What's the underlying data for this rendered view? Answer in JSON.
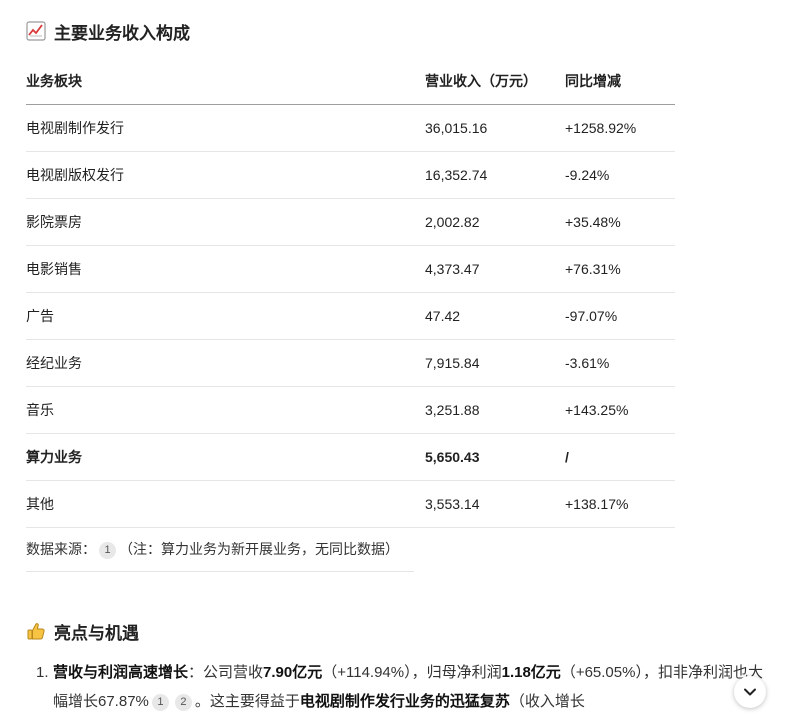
{
  "section1": {
    "icon": "chart-increasing-icon",
    "title": "主要业务收入构成"
  },
  "table": {
    "headers": [
      "业务板块",
      "营业收入（万元）",
      "同比增减"
    ],
    "rows": [
      [
        "电视剧制作发行",
        "36,015.16",
        "+1258.92%"
      ],
      [
        "电视剧版权发行",
        "16,352.74",
        "-9.24%"
      ],
      [
        "影院票房",
        "2,002.82",
        "+35.48%"
      ],
      [
        "电影销售",
        "4,373.47",
        "+76.31%"
      ],
      [
        "广告",
        "47.42",
        "-97.07%"
      ],
      [
        "经纪业务",
        "7,915.84",
        "-3.61%"
      ],
      [
        "音乐",
        "3,251.88",
        "+143.25%"
      ],
      [
        "算力业务",
        "5,650.43",
        "/"
      ],
      [
        "其他",
        "3,553.14",
        "+138.17%"
      ]
    ]
  },
  "note": {
    "prefix": "数据来源：",
    "ref": "1",
    "text": "（注：算力业务为新开展业务，无同比数据）"
  },
  "section2": {
    "icon": "thumbs-up-icon",
    "title": "亮点与机遇"
  },
  "highlights": {
    "num": "1.",
    "lead": "营收与利润高速增长",
    "t1": "：公司营收",
    "v1": "7.90亿元",
    "t2": "（+114.94%），归母净利润",
    "v2": "1.18亿元",
    "t3": "（+65.05%），扣非净利润也大幅增长67.87%",
    "ref1": "1",
    "ref2": "2",
    "t4": "。这主要得益于",
    "v3": "电视剧制作发行业务的迅猛复苏",
    "t5": "（收入增长"
  }
}
